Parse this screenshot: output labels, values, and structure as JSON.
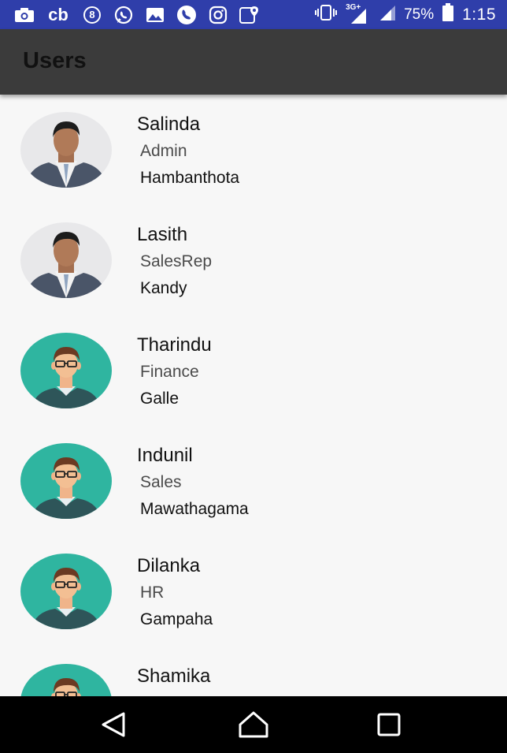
{
  "status_bar": {
    "icons": [
      "camera-icon",
      "cb-icon",
      "eight-icon",
      "whatsapp-icon",
      "image-icon",
      "phone-icon",
      "instagram-icon",
      "location-icon"
    ],
    "cb_text": "cb",
    "eight_text": "8",
    "network_label": "3G+",
    "battery": "75%",
    "time": "1:15"
  },
  "app_bar": {
    "title": "Users"
  },
  "users": [
    {
      "name": "Salinda",
      "role": "Admin",
      "city": "Hambanthota",
      "avatar": "photo"
    },
    {
      "name": "Lasith",
      "role": "SalesRep",
      "city": "Kandy",
      "avatar": "photo"
    },
    {
      "name": "Tharindu",
      "role": "Finance",
      "city": "Galle",
      "avatar": "illustration"
    },
    {
      "name": "Indunil",
      "role": "Sales",
      "city": "Mawathagama",
      "avatar": "illustration"
    },
    {
      "name": "Dilanka",
      "role": "HR",
      "city": "Gampaha",
      "avatar": "illustration"
    },
    {
      "name": "Shamika",
      "role": "",
      "city": "",
      "avatar": "illustration"
    }
  ],
  "nav_bar": {
    "buttons": [
      "back-icon",
      "home-icon",
      "recents-icon"
    ]
  },
  "colors": {
    "status_bar": "#2f3eaa",
    "app_bar": "#3b3b3b",
    "avatar_teal": "#2fb5a0",
    "background": "#f7f7f7"
  }
}
